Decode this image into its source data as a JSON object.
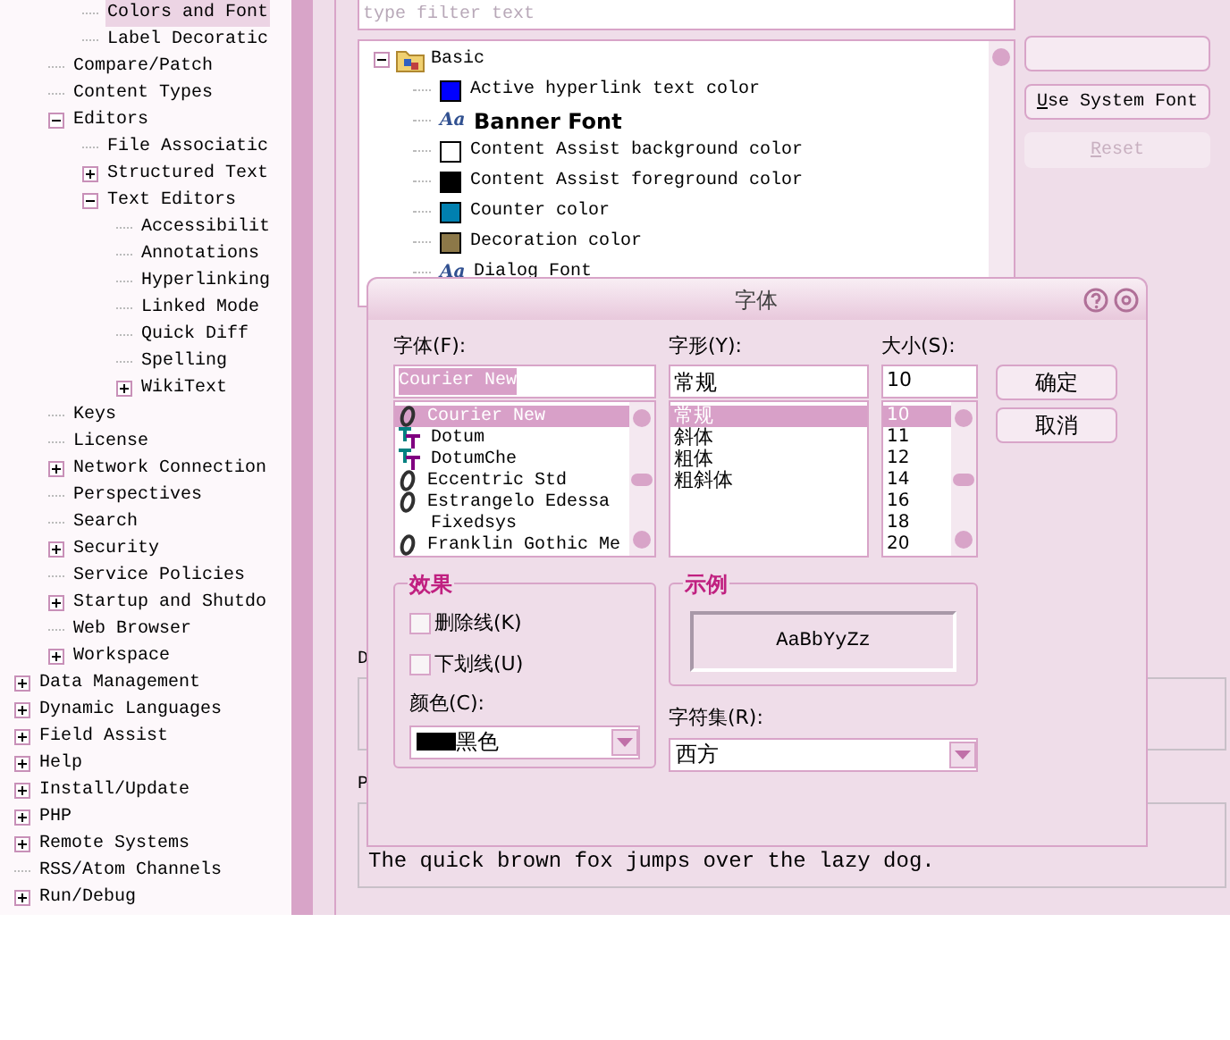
{
  "tree": {
    "items": [
      {
        "children": [
          {
            "children": [
              {
                "label": "Colors and Font",
                "selected": true
              },
              {
                "label": "Label Decoratic",
                "selected": false
              }
            ]
          },
          {
            "label": "Compare/Patch",
            "selected": false
          },
          {
            "label": "Content Types",
            "selected": false
          },
          {
            "label": "Editors",
            "selected": false,
            "expanded": true,
            "children": [
              {
                "label": "File Associatic",
                "selected": false
              },
              {
                "label": "Structured Text",
                "selected": false,
                "expanded": false
              },
              {
                "label": "Text Editors",
                "selected": false,
                "expanded": true,
                "children": [
                  {
                    "label": "Accessibilit",
                    "selected": false
                  },
                  {
                    "label": "Annotations",
                    "selected": false
                  },
                  {
                    "label": "Hyperlinking",
                    "selected": false
                  },
                  {
                    "label": "Linked Mode",
                    "selected": false
                  },
                  {
                    "label": "Quick Diff",
                    "selected": false
                  },
                  {
                    "label": "Spelling",
                    "selected": false
                  },
                  {
                    "label": "WikiText",
                    "selected": false,
                    "expanded": false
                  }
                ]
              }
            ]
          },
          {
            "label": "Keys",
            "selected": false
          },
          {
            "label": "License",
            "selected": false
          },
          {
            "label": "Network Connection",
            "selected": false,
            "expanded": false
          },
          {
            "label": "Perspectives",
            "selected": false
          },
          {
            "label": "Search",
            "selected": false
          },
          {
            "label": "Security",
            "selected": false,
            "expanded": false
          },
          {
            "label": "Service Policies",
            "selected": false
          },
          {
            "label": "Startup and Shutdo",
            "selected": false,
            "expanded": false
          },
          {
            "label": "Web Browser",
            "selected": false
          },
          {
            "label": "Workspace",
            "selected": false,
            "expanded": false
          }
        ]
      },
      {
        "label": "Data Management",
        "selected": false,
        "expanded": false
      },
      {
        "label": "Dynamic Languages",
        "selected": false,
        "expanded": false
      },
      {
        "label": "Field Assist",
        "selected": false,
        "expanded": false
      },
      {
        "label": "Help",
        "selected": false,
        "expanded": false
      },
      {
        "label": "Install/Update",
        "selected": false,
        "expanded": false
      },
      {
        "label": "PHP",
        "selected": false,
        "expanded": false
      },
      {
        "label": "Remote Systems",
        "selected": false,
        "expanded": false
      },
      {
        "label": "RSS/Atom Channels",
        "selected": false
      },
      {
        "label": "Run/Debug",
        "selected": false,
        "expanded": false
      }
    ]
  },
  "filter": {
    "placeholder": "type filter text"
  },
  "colors_tree": {
    "label": "Basic",
    "expanded": true,
    "children": [
      {
        "kind": "color",
        "color": "#0000ff",
        "label": "Active hyperlink text color",
        "bold": false
      },
      {
        "kind": "font",
        "icon_text": "Aa",
        "label": "Banner Font",
        "bold": true
      },
      {
        "kind": "color",
        "color": "#ffffff",
        "label": "Content Assist background color",
        "bold": false
      },
      {
        "kind": "color",
        "color": "#000000",
        "label": "Content Assist foreground color",
        "bold": false
      },
      {
        "kind": "color",
        "color": "#0080b0",
        "label": "Counter color",
        "bold": false
      },
      {
        "kind": "color",
        "color": "#8c7848",
        "label": "Decoration color",
        "bold": false
      },
      {
        "kind": "font",
        "icon_text": "Aa",
        "label": "Dialog Font",
        "bold": false
      }
    ]
  },
  "side_buttons": [
    {
      "disabled": false
    },
    {
      "label": "Use System Font",
      "underline_first": true,
      "disabled": false
    },
    {
      "label": "Reset",
      "underline_first": true,
      "disabled": true
    }
  ],
  "description": {
    "label": "D"
  },
  "preview": {
    "label": "P",
    "text": "The quick brown fox jumps over the lazy dog."
  },
  "dialog": {
    "title": "字体",
    "font": {
      "label": "字体(F):",
      "value": "Courier New",
      "items": [
        {
          "kind": "opentype",
          "label": "Courier New",
          "selected": true
        },
        {
          "kind": "truetype",
          "label": "Dotum",
          "selected": false
        },
        {
          "kind": "truetype",
          "label": "DotumChe",
          "selected": false
        },
        {
          "kind": "opentype",
          "label": "Eccentric Std",
          "selected": false
        },
        {
          "kind": "opentype",
          "label": "Estrangelo Edessa",
          "selected": false
        },
        {
          "kind": "none",
          "label": "Fixedsys",
          "selected": false
        },
        {
          "kind": "opentype",
          "label": "Franklin Gothic Me",
          "selected": false
        }
      ]
    },
    "style": {
      "label": "字形(Y):",
      "value": "常规",
      "items": [
        {
          "label": "常规",
          "selected": true
        },
        {
          "label": "斜体",
          "selected": false
        },
        {
          "label": "粗体",
          "selected": false
        },
        {
          "label": "粗斜体",
          "selected": false
        }
      ]
    },
    "size": {
      "label": "大小(S):",
      "value": "10",
      "items": [
        {
          "label": "10",
          "selected": true
        },
        {
          "label": "11",
          "selected": false
        },
        {
          "label": "12",
          "selected": false
        },
        {
          "label": "14",
          "selected": false
        },
        {
          "label": "16",
          "selected": false
        },
        {
          "label": "18",
          "selected": false
        },
        {
          "label": "20",
          "selected": false
        }
      ]
    },
    "buttons": [
      "确定",
      "取消"
    ],
    "effects": {
      "title": "效果",
      "checks": [
        {
          "label": "删除线(K)",
          "checked": false
        },
        {
          "label": "下划线(U)",
          "checked": false
        }
      ],
      "color_label": "颜色(C):",
      "color": {
        "color": "#000000",
        "label": "黑色"
      }
    },
    "sample": {
      "title": "示例",
      "text": "AaBbYyZz"
    },
    "charset": {
      "label": "字符集(R):",
      "value": "西方"
    }
  }
}
